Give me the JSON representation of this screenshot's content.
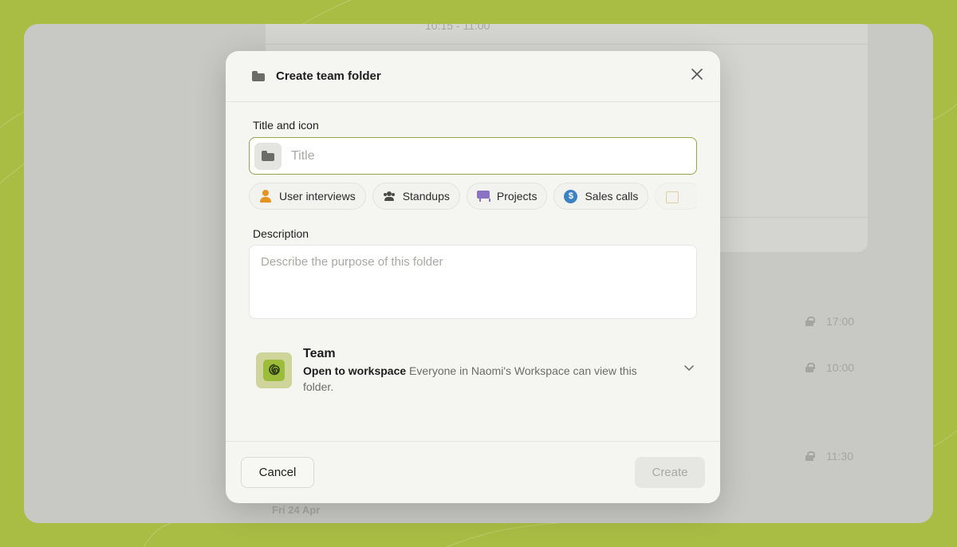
{
  "background": {
    "top_text": "10:15 - 11:00",
    "times": [
      "17:00",
      "10:00",
      "11:30"
    ],
    "date_label": "Fri 24 Apr"
  },
  "modal": {
    "title": "Create team folder",
    "title_section_label": "Title and icon",
    "title_placeholder": "Title",
    "templates": [
      {
        "label": "User interviews",
        "icon": "user-icon"
      },
      {
        "label": "Standups",
        "icon": "people-icon"
      },
      {
        "label": "Projects",
        "icon": "presentation-board-icon"
      },
      {
        "label": "Sales calls",
        "icon": "dollar-icon"
      },
      {
        "label": "",
        "icon": "calendar-icon"
      }
    ],
    "description_label": "Description",
    "description_placeholder": "Describe the purpose of this folder",
    "team": {
      "name": "Team",
      "access_title": "Open to workspace",
      "access_description": "Everyone in Naomi's Workspace can view this folder."
    },
    "cancel_label": "Cancel",
    "create_label": "Create"
  },
  "colors": {
    "frame": "#a9bd45",
    "input_focus_border": "#93a64a",
    "team_avatar": "#9bbd3a"
  }
}
